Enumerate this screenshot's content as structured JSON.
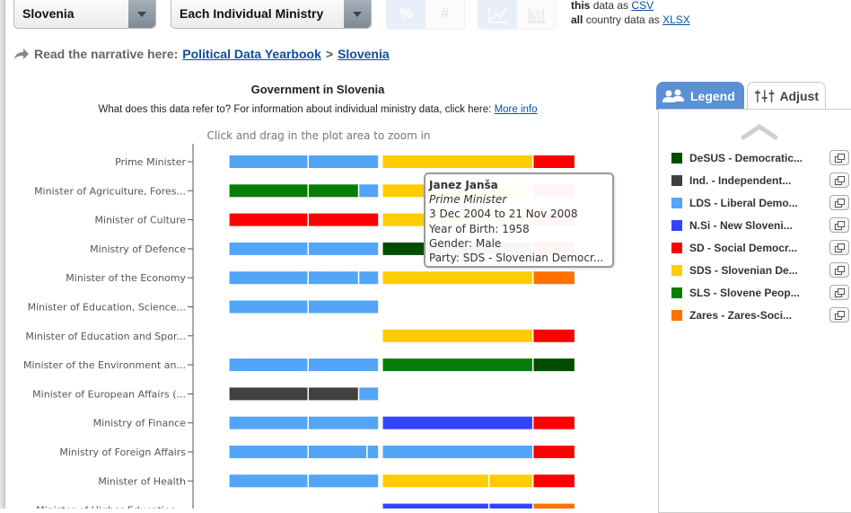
{
  "toolbar": {
    "country_select": "Slovenia",
    "view_select": "Each Individual Ministry",
    "unit_toggle": [
      {
        "label": "%",
        "active": true
      },
      {
        "label": "#",
        "active": false
      }
    ],
    "chart_toggle": [
      {
        "icon": "line-chart-icon",
        "active": true
      },
      {
        "icon": "bar-chart-icon",
        "active": false
      }
    ],
    "download_this_prefix": "this",
    "download_this_text": "data as",
    "download_this_link": "CSV",
    "download_all_prefix": "all",
    "download_all_text": "country data as",
    "download_all_link": "XLSX"
  },
  "narrative": {
    "label": "Read the narrative here:",
    "link1": "Political Data Yearbook",
    "separator": ">",
    "link2": "Slovenia"
  },
  "chart_data": {
    "type": "timeline-bar",
    "title": "Government in Slovenia",
    "subtitle": "What does this data refer to? For information about individual ministry data, click here:",
    "subtitle_link": "More info",
    "hint": "Click and drag in the plot area to zoom in",
    "x_unit": "year",
    "xlim": [
      2000.5,
      2010.8
    ],
    "categories": [
      "Prime Minister",
      "Minister of Agriculture, Fores...",
      "Minister of Culture",
      "Ministry of Defence",
      "Minister of the Economy",
      "Minister of Education, Science...",
      "Minister of Education and Spor...",
      "Minister of the Environment an...",
      "Minister of European Affairs (...",
      "Ministry of Finance",
      "Ministry of Foreign Affairs",
      "Minister of Health",
      "Minister of Higher Education..."
    ],
    "parties": {
      "DeSUS": "#004d00",
      "Ind.": "#404040",
      "LDS": "#52a5f7",
      "N.Si": "#3344ff",
      "SD": "#ff0000",
      "SDS": "#ffcc00",
      "SLS": "#087d08",
      "Zares": "#ff7200"
    },
    "rows": [
      [
        [
          "LDS",
          2000.88,
          2002.97
        ],
        [
          "LDS",
          2002.97,
          2004.83
        ],
        [
          "SDS",
          2004.92,
          2008.89
        ],
        [
          "SD",
          2008.89,
          2010.0
        ]
      ],
      [
        [
          "SLS",
          2000.88,
          2002.97
        ],
        [
          "SLS",
          2002.97,
          2004.3
        ],
        [
          "LDS",
          2004.3,
          2004.83
        ],
        [
          "SDS",
          2004.92,
          2008.89
        ],
        [
          "SD",
          2008.89,
          2010.0
        ]
      ],
      [
        [
          "SD",
          2000.88,
          2002.97
        ],
        [
          "SD",
          2002.97,
          2004.83
        ],
        [
          "SDS",
          2004.92,
          2008.89
        ],
        [
          "SD",
          2008.89,
          2010.0
        ]
      ],
      [
        [
          "LDS",
          2000.88,
          2002.97
        ],
        [
          "LDS",
          2002.97,
          2004.83
        ],
        [
          "DeSUS",
          2004.92,
          2008.89
        ],
        [
          "SD",
          2008.89,
          2010.0
        ]
      ],
      [
        [
          "LDS",
          2000.88,
          2002.97
        ],
        [
          "LDS",
          2002.97,
          2004.3
        ],
        [
          "LDS",
          2004.3,
          2004.83
        ],
        [
          "SDS",
          2004.92,
          2008.89
        ],
        [
          "Zares",
          2008.89,
          2010.0
        ]
      ],
      [
        [
          "LDS",
          2000.88,
          2002.97
        ],
        [
          "LDS",
          2002.97,
          2004.83
        ]
      ],
      [
        [
          "SDS",
          2004.92,
          2008.89
        ],
        [
          "SD",
          2008.89,
          2010.0
        ]
      ],
      [
        [
          "LDS",
          2000.88,
          2002.97
        ],
        [
          "LDS",
          2002.97,
          2004.83
        ],
        [
          "SLS",
          2004.92,
          2008.89
        ],
        [
          "DeSUS",
          2008.89,
          2010.0
        ]
      ],
      [
        [
          "Ind.",
          2000.88,
          2002.97
        ],
        [
          "Ind.",
          2002.97,
          2004.3
        ],
        [
          "LDS",
          2004.3,
          2004.83
        ]
      ],
      [
        [
          "LDS",
          2000.88,
          2002.97
        ],
        [
          "LDS",
          2002.97,
          2004.83
        ],
        [
          "N.Si",
          2004.92,
          2008.89
        ],
        [
          "SD",
          2008.89,
          2010.0
        ]
      ],
      [
        [
          "LDS",
          2000.88,
          2002.97
        ],
        [
          "LDS",
          2002.97,
          2004.52
        ],
        [
          "LDS",
          2004.52,
          2004.83
        ],
        [
          "LDS",
          2004.92,
          2008.89
        ],
        [
          "SD",
          2008.89,
          2010.0
        ]
      ],
      [
        [
          "LDS",
          2000.88,
          2002.97
        ],
        [
          "LDS",
          2002.97,
          2004.83
        ],
        [
          "SDS",
          2004.92,
          2007.73
        ],
        [
          "SDS",
          2007.73,
          2008.89
        ],
        [
          "SD",
          2008.89,
          2010.0
        ]
      ],
      [
        [
          "N.Si",
          2004.92,
          2007.73
        ],
        [
          "N.Si",
          2007.73,
          2008.89
        ],
        [
          "Zares",
          2008.89,
          2010.0
        ]
      ]
    ]
  },
  "tooltip": {
    "name": "Janez Janša",
    "role": "Prime Minister",
    "period": "3 Dec 2004 to 21 Nov 2008",
    "birth": "Year of Birth: 1958",
    "gender": "Gender: Male",
    "party": "Party: SDS - Slovenian Democr..."
  },
  "legend_panel": {
    "tab_legend": "Legend",
    "tab_adjust": "Adjust",
    "items": [
      {
        "label": "DeSUS - Democratic...",
        "color": "#004d00"
      },
      {
        "label": "Ind. - Independent...",
        "color": "#404040"
      },
      {
        "label": "LDS - Liberal Demo...",
        "color": "#52a5f7"
      },
      {
        "label": "N.Si - New Sloveni...",
        "color": "#3344ff"
      },
      {
        "label": "SD - Social Democr...",
        "color": "#ff0000"
      },
      {
        "label": "SDS - Slovenian De...",
        "color": "#ffcc00"
      },
      {
        "label": "SLS - Slovene Peop...",
        "color": "#087d08"
      },
      {
        "label": "Zares - Zares-Soci...",
        "color": "#ff7200"
      }
    ]
  }
}
